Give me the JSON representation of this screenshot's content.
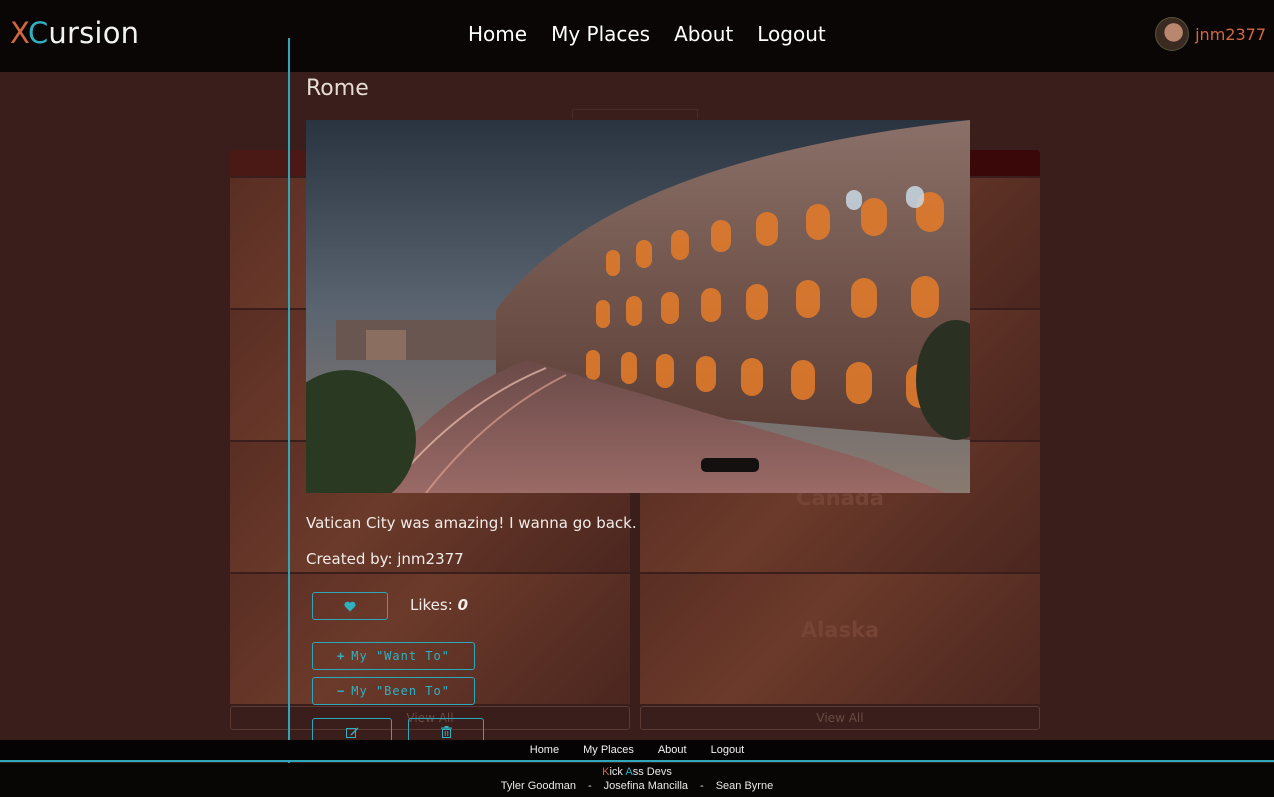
{
  "brand": {
    "x": "X",
    "c": "C",
    "rest": "ursion"
  },
  "nav": {
    "home": "Home",
    "my_places": "My Places",
    "about": "About",
    "logout": "Logout"
  },
  "user": {
    "username": "jnm2377"
  },
  "background": {
    "left_tiles": [
      "",
      "",
      "",
      ""
    ],
    "right_tiles": [
      "",
      "",
      "Canada",
      "Alaska"
    ],
    "view_all": "View All"
  },
  "modal": {
    "title": "Rome",
    "description": "Vatican City was amazing! I wanna go back.",
    "created_by": "Created by: jnm2377",
    "likes_label": "Likes:",
    "likes_count": "0",
    "want_to_label": "My \"Want To\"",
    "been_to_label": "My \"Been To\""
  },
  "footer": {
    "nav": {
      "home": "Home",
      "my_places": "My Places",
      "about": "About",
      "logout": "Logout"
    },
    "credit": {
      "k": "K",
      "ick": "ick ",
      "a": "A",
      "ss": "ss Devs"
    },
    "devs": [
      "Tyler Goodman",
      "-",
      "Josefina Mancilla",
      "-",
      "Sean Byrne"
    ]
  },
  "colors": {
    "accent": "#2fb1c2",
    "brand_orange": "#d3683f",
    "navbar": "#0b0606",
    "page_bg": "#3a1e1b"
  }
}
